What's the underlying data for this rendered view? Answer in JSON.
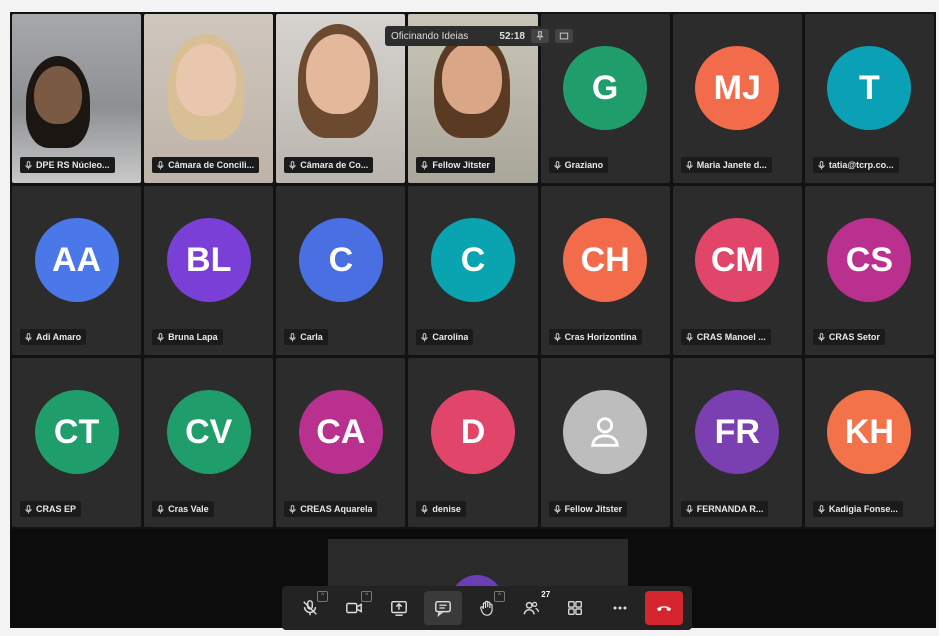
{
  "meeting": {
    "pinned_title": "Oficinando Ideias",
    "timer": "52:18"
  },
  "participants": [
    {
      "type": "video",
      "name": "DPE RS Núcleo..."
    },
    {
      "type": "video",
      "name": "Câmara de Concili..."
    },
    {
      "type": "video",
      "name": "Câmara de Co..."
    },
    {
      "type": "video",
      "name": "Fellow Jitster"
    },
    {
      "type": "avatar",
      "initials": "G",
      "name": "Graziano",
      "color": "#1f9e6c"
    },
    {
      "type": "avatar",
      "initials": "MJ",
      "name": "Maria Janete d...",
      "color": "#f26b4a"
    },
    {
      "type": "avatar",
      "initials": "T",
      "name": "tatia@tcrp.co...",
      "color": "#0aa1b7"
    },
    {
      "type": "avatar",
      "initials": "AA",
      "name": "Adi Amaro",
      "color": "#4a78e8"
    },
    {
      "type": "avatar",
      "initials": "BL",
      "name": "Bruna Lapa",
      "color": "#7a3fd6"
    },
    {
      "type": "avatar",
      "initials": "C",
      "name": "Carla",
      "color": "#4a6fe2"
    },
    {
      "type": "avatar",
      "initials": "C",
      "name": "Carolina",
      "color": "#0aa3b0"
    },
    {
      "type": "avatar",
      "initials": "CH",
      "name": "Cras Horizontina",
      "color": "#f26b4a"
    },
    {
      "type": "avatar",
      "initials": "CM",
      "name": "CRAS Manoel ...",
      "color": "#e2456a"
    },
    {
      "type": "avatar",
      "initials": "CS",
      "name": "CRAS Setor",
      "color": "#b9308f"
    },
    {
      "type": "avatar",
      "initials": "CT",
      "name": "CRAS EP",
      "color": "#1f9e6c"
    },
    {
      "type": "avatar",
      "initials": "CV",
      "name": "Cras Vale",
      "color": "#1f9e6c"
    },
    {
      "type": "avatar",
      "initials": "CA",
      "name": "CREAS Aquarela",
      "color": "#b9308f"
    },
    {
      "type": "avatar",
      "initials": "D",
      "name": "denise",
      "color": "#e2456a"
    },
    {
      "type": "avatar",
      "initials": "",
      "name": "Fellow Jitster",
      "color": "#bdbdbd",
      "icon": "person-icon"
    },
    {
      "type": "avatar",
      "initials": "FR",
      "name": "FERNANDA R...",
      "color": "#7a3fb0"
    },
    {
      "type": "avatar",
      "initials": "KH",
      "name": "Kadigia Fonse...",
      "color": "#f2724a"
    }
  ],
  "toolbar": {
    "buttons": [
      {
        "name": "mic-button",
        "icon": "mic-off-icon",
        "has_caret": true
      },
      {
        "name": "camera-button",
        "icon": "camera-icon",
        "has_caret": true
      },
      {
        "name": "share-screen-button",
        "icon": "share-screen-icon"
      },
      {
        "name": "chat-button",
        "icon": "chat-icon",
        "selected": true
      },
      {
        "name": "reactions-button",
        "icon": "hand-icon",
        "has_caret": true
      },
      {
        "name": "participants-button",
        "icon": "people-icon",
        "count": "27"
      },
      {
        "name": "layout-button",
        "icon": "grid-icon"
      },
      {
        "name": "more-options-button",
        "icon": "more-icon"
      },
      {
        "name": "leave-call-button",
        "icon": "phone-hangup-icon",
        "color": "#d5262f"
      }
    ]
  }
}
